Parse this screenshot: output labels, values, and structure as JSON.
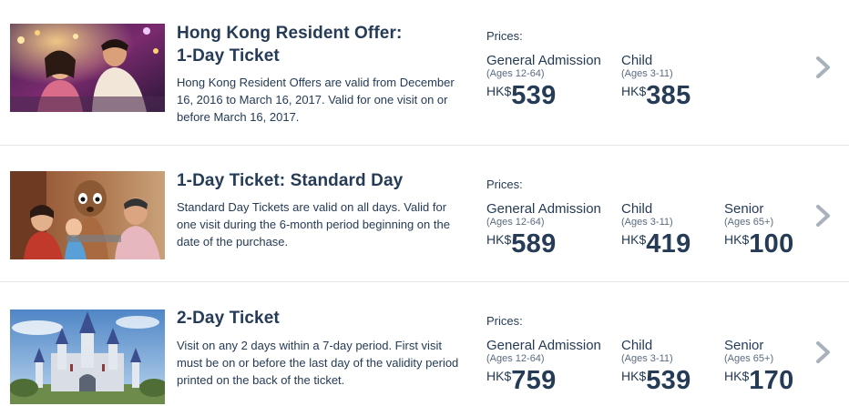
{
  "tickets": [
    {
      "title_line1": "Hong Kong Resident Offer:",
      "title_line2": "1-Day Ticket",
      "description": "Hong Kong Resident Offers are valid from December 16, 2016 to March 16, 2017. Valid for one visit on or before March 16, 2017.",
      "prices_label": "Prices:",
      "prices": [
        {
          "category": "General Admission",
          "ages": "(Ages 12-64)",
          "currency": "HK$",
          "amount": "539"
        },
        {
          "category": "Child",
          "ages": "(Ages 3-11)",
          "currency": "HK$",
          "amount": "385"
        }
      ]
    },
    {
      "title_line1": "1-Day Ticket: Standard Day",
      "title_line2": "",
      "description": "Standard Day Tickets are valid on all days. Valid for one visit during the 6-month period beginning on the date of the purchase.",
      "prices_label": "Prices:",
      "prices": [
        {
          "category": "General Admission",
          "ages": "(Ages 12-64)",
          "currency": "HK$",
          "amount": "589"
        },
        {
          "category": "Child",
          "ages": "(Ages 3-11)",
          "currency": "HK$",
          "amount": "419"
        },
        {
          "category": "Senior",
          "ages": "(Ages 65+)",
          "currency": "HK$",
          "amount": "100"
        }
      ]
    },
    {
      "title_line1": "2-Day Ticket",
      "title_line2": "",
      "description": "Visit on any 2 days within a 7-day period. First visit must be on or before the last day of the validity period printed on the back of the ticket.",
      "prices_label": "Prices:",
      "prices": [
        {
          "category": "General Admission",
          "ages": "(Ages 12-64)",
          "currency": "HK$",
          "amount": "759"
        },
        {
          "category": "Child",
          "ages": "(Ages 3-11)",
          "currency": "HK$",
          "amount": "539"
        },
        {
          "category": "Senior",
          "ages": "(Ages 65+)",
          "currency": "HK$",
          "amount": "170"
        }
      ]
    }
  ],
  "icons": {
    "chevron": "chevron-right-icon"
  },
  "colors": {
    "text": "#253b56",
    "chevron": "#a9b1bc",
    "divider": "#e3e6ea"
  }
}
